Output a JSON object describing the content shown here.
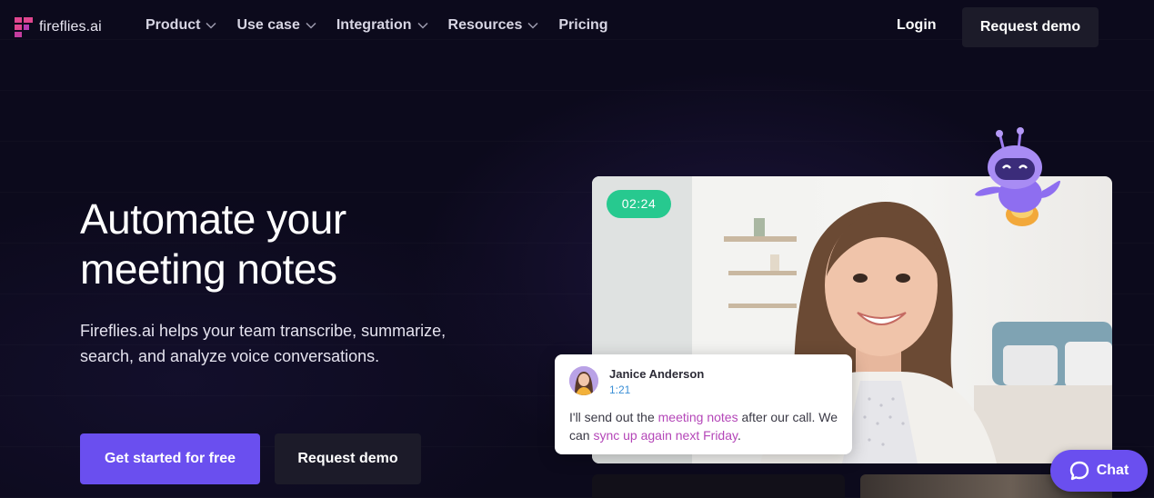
{
  "brand": {
    "logo_text": "fireflies.ai",
    "logo_icon": "fireflies-logo-icon",
    "accent": "#6a4fef",
    "logo_color": "#e0468f"
  },
  "nav": {
    "items": [
      {
        "label": "Product",
        "has_dropdown": true
      },
      {
        "label": "Use case",
        "has_dropdown": true
      },
      {
        "label": "Integration",
        "has_dropdown": true
      },
      {
        "label": "Resources",
        "has_dropdown": true
      },
      {
        "label": "Pricing",
        "has_dropdown": false
      }
    ],
    "login_label": "Login",
    "request_demo_label": "Request demo"
  },
  "hero": {
    "title_line1": "Automate your",
    "title_line2": "meeting notes",
    "subtitle": "Fireflies.ai helps your team transcribe, summarize, search, and analyze voice conversations.",
    "primary_cta": "Get started for free",
    "secondary_cta": "Request demo"
  },
  "video": {
    "timer": "02:24",
    "timer_color": "#27c98f",
    "transcript": {
      "speaker": "Janice Anderson",
      "timestamp": "1:21",
      "text_part1": "I'll send out the ",
      "highlight1": "meeting notes",
      "text_part2": " after our call. We can ",
      "highlight2": "sync up again next Friday",
      "text_part3": "."
    }
  },
  "chat": {
    "label": "Chat",
    "icon": "chat-bubble-icon"
  }
}
